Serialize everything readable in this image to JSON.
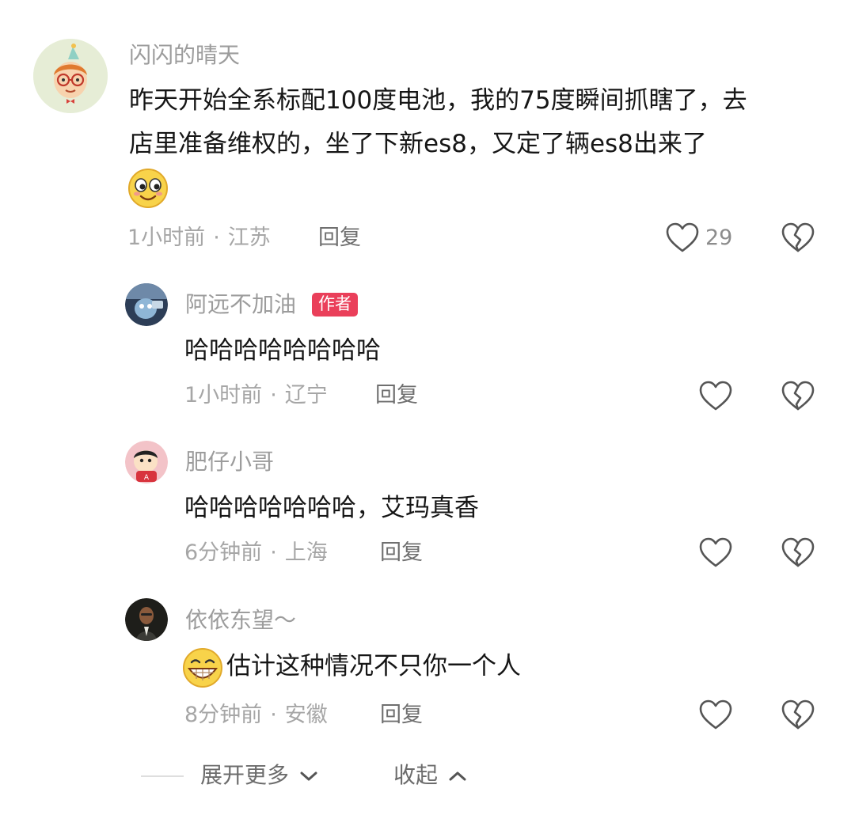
{
  "comments": [
    {
      "username": "闪闪的晴天",
      "text_line1": "昨天开始全系标配100度电池，我的75度瞬间抓瞎了，去",
      "text_line2": "店里准备维权的，坐了下新es8，又定了辆es8出来了",
      "emoji": "smirk-emoji",
      "time": "1小时前",
      "location": "江苏",
      "reply_label": "回复",
      "like_count": "29"
    },
    {
      "username": "阿远不加油",
      "badge": "作者",
      "text": "哈哈哈哈哈哈哈哈",
      "time": "1小时前",
      "location": "辽宁",
      "reply_label": "回复"
    },
    {
      "username": "肥仔小哥",
      "text": "哈哈哈哈哈哈哈，艾玛真香",
      "time": "6分钟前",
      "location": "上海",
      "reply_label": "回复"
    },
    {
      "username": "依依东望～",
      "emoji": "grin-emoji",
      "text": "估计这种情况不只你一个人",
      "time": "8分钟前",
      "location": "安徽",
      "reply_label": "回复"
    }
  ],
  "separator": "·",
  "footer": {
    "expand_label": "展开更多",
    "collapse_label": "收起"
  },
  "colors": {
    "author_badge": "#ea3f5a",
    "username": "#9c9c9c",
    "meta": "#a6a6a6"
  },
  "icons": {
    "like": "heart-outline-icon",
    "dislike": "broken-heart-icon",
    "expand": "chevron-down-icon",
    "collapse": "chevron-up-icon"
  }
}
